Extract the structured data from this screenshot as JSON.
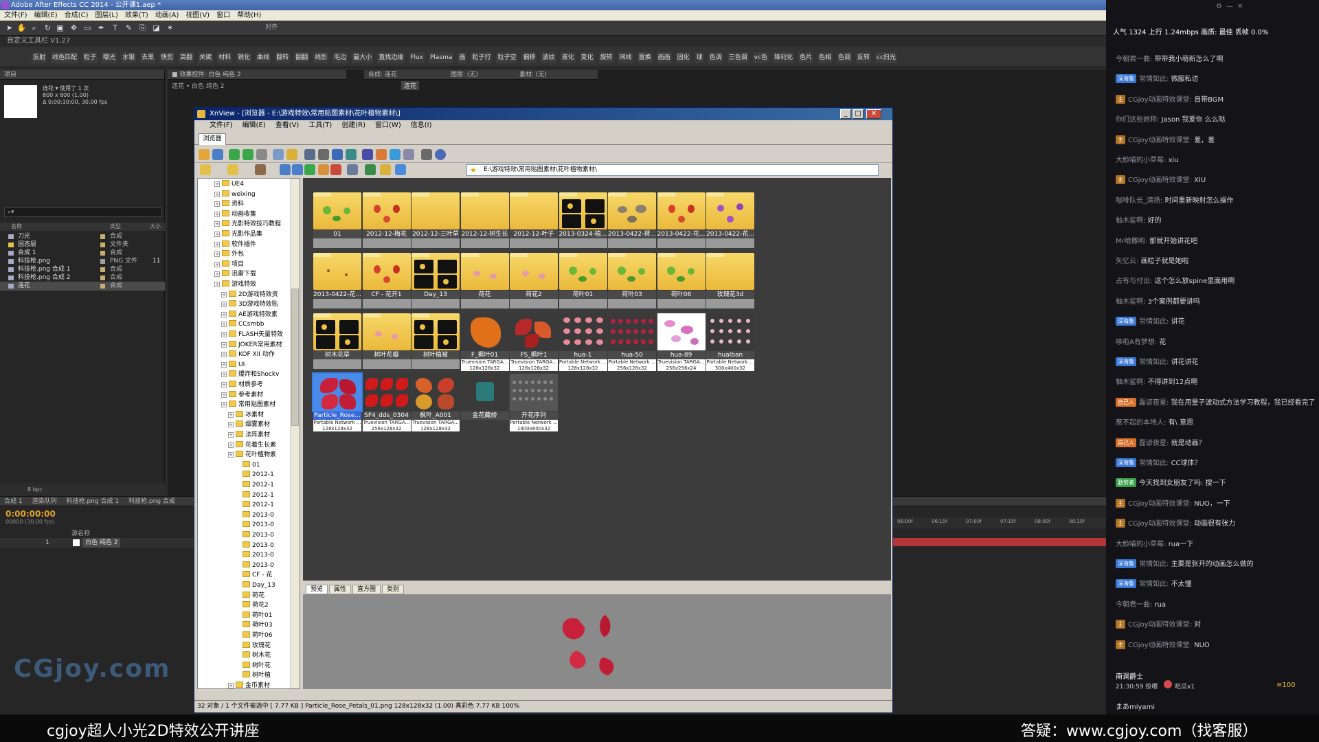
{
  "ae": {
    "title": "Adobe After Effects CC 2014 - 公开课1.aep *",
    "menu": [
      "文件(F)",
      "编辑(E)",
      "合成(C)",
      "图层(L)",
      "效果(T)",
      "动画(A)",
      "视图(V)",
      "窗口",
      "帮助(H)"
    ],
    "workspace": "自定义工具栏 V1.27",
    "snap_label": "对齐",
    "fx_buttons": [
      "反射",
      "线色匹配",
      "粒子",
      "曝光",
      "水银",
      "去黑",
      "快剪",
      "高翻",
      "关键",
      "材料",
      "锐化",
      "曲线",
      "翻转",
      "翻翻",
      "线影",
      "毛边",
      "最大小",
      "直找边缘",
      "Flux",
      "Plasma",
      "画",
      "粒子打",
      "粒子空",
      "偏移",
      "波纹",
      "液化",
      "变化",
      "旋转",
      "网线",
      "置换",
      "画画",
      "固化",
      "球",
      "色调",
      "三色调",
      "vc色",
      "锋利化",
      "色片",
      "色相",
      "色调",
      "反转",
      "cc扫光"
    ],
    "project": {
      "tab": "项目",
      "item_name": "连花",
      "used": "使用了 1 次",
      "meta": [
        "800 x 800 (1.00)",
        "Δ 0:00:10:00, 30.00 fps"
      ],
      "columns": [
        "名称",
        "类型",
        "大小"
      ],
      "rows": [
        {
          "name": "刀光",
          "type": "合成"
        },
        {
          "name": "固态层",
          "type": "文件夹"
        },
        {
          "name": "合成 1",
          "type": "合成"
        },
        {
          "name": "科技枪.png",
          "type": "PNG 文件",
          "size": "11"
        },
        {
          "name": "科技枪.png 合成 1",
          "type": "合成"
        },
        {
          "name": "科技枪.png 合成 2",
          "type": "合成"
        },
        {
          "name": "连花",
          "type": "合成"
        }
      ],
      "bpc": "8 bpc"
    },
    "effect_controls_tab": "效果控件: 白色 纯色 2",
    "effect_subtitle": "连花 • 白色 纯色 2",
    "comp_tab": "合成: 连花",
    "comp_sub": "连花",
    "layer_tab": "图层: (无)",
    "footage_tab": "素材: (无)",
    "timeline": {
      "tabs": [
        "合成 1",
        "渲染队列",
        "科技枪.png 合成 1",
        "科技枪.png 合成"
      ],
      "time": "0:00:00:00",
      "fps": "00000 (30.00 fps)",
      "layer_header": "源名称",
      "layer_index": "1",
      "layer_name": "白色 纯色 2",
      "ticks": [
        "06:00f",
        "06:15f",
        "07:00f",
        "07:15f",
        "08:00f",
        "08:15f"
      ]
    },
    "watermark": "CGjoy.com"
  },
  "xnview": {
    "title": "XnView - [浏览器 - E:\\游戏特效\\常用贴图素材\\花叶植物素材\\]",
    "menu": [
      "文件(F)",
      "编辑(E)",
      "查看(V)",
      "工具(T)",
      "创建(R)",
      "窗口(W)",
      "信息(I)"
    ],
    "tab": "浏览器",
    "address": "E:\\游戏特效\\常用贴图素材\\花叶植物素材\\",
    "tree": [
      {
        "label": "UE4",
        "lvl": 1
      },
      {
        "label": "weixing",
        "lvl": 1
      },
      {
        "label": "资料",
        "lvl": 1
      },
      {
        "label": "动画收集",
        "lvl": 1
      },
      {
        "label": "光影特效技巧教程",
        "lvl": 1
      },
      {
        "label": "光影作品集",
        "lvl": 1
      },
      {
        "label": "软件插件",
        "lvl": 1
      },
      {
        "label": "外包",
        "lvl": 1
      },
      {
        "label": "项目",
        "lvl": 1
      },
      {
        "label": "迅雷下载",
        "lvl": 1
      },
      {
        "label": "游戏特效",
        "lvl": 1
      },
      {
        "label": "2D游戏特效资",
        "lvl": 2
      },
      {
        "label": "3D游戏特效贴",
        "lvl": 2
      },
      {
        "label": "AE游戏特效素",
        "lvl": 2
      },
      {
        "label": "CCsmbb",
        "lvl": 2
      },
      {
        "label": "FLASH矢量特效",
        "lvl": 2
      },
      {
        "label": "JOKER常用素材",
        "lvl": 2
      },
      {
        "label": "KOF XII 动作",
        "lvl": 2
      },
      {
        "label": "UI",
        "lvl": 2
      },
      {
        "label": "爆炸和Shockv",
        "lvl": 2
      },
      {
        "label": "材质参考",
        "lvl": 2
      },
      {
        "label": "参考素材",
        "lvl": 2
      },
      {
        "label": "常用贴图素材",
        "lvl": 2
      },
      {
        "label": "冰素材",
        "lvl": 3
      },
      {
        "label": "烟雾素材",
        "lvl": 3
      },
      {
        "label": "法阵素材",
        "lvl": 3
      },
      {
        "label": "花着生长素",
        "lvl": 3
      },
      {
        "label": "花叶植物素",
        "lvl": 3
      },
      {
        "label": "01",
        "lvl": 4
      },
      {
        "label": "2012-1",
        "lvl": 4
      },
      {
        "label": "2012-1",
        "lvl": 4
      },
      {
        "label": "2012-1",
        "lvl": 4
      },
      {
        "label": "2012-1",
        "lvl": 4
      },
      {
        "label": "2013-0",
        "lvl": 4
      },
      {
        "label": "2013-0",
        "lvl": 4
      },
      {
        "label": "2013-0",
        "lvl": 4
      },
      {
        "label": "2013-0",
        "lvl": 4
      },
      {
        "label": "2013-0",
        "lvl": 4
      },
      {
        "label": "2013-0",
        "lvl": 4
      },
      {
        "label": "CF - 花",
        "lvl": 4
      },
      {
        "label": "Day_13",
        "lvl": 4
      },
      {
        "label": "荷花",
        "lvl": 4
      },
      {
        "label": "荷花2",
        "lvl": 4
      },
      {
        "label": "荷叶01",
        "lvl": 4
      },
      {
        "label": "荷叶03",
        "lvl": 4
      },
      {
        "label": "荷叶06",
        "lvl": 4
      },
      {
        "label": "玫瑰花",
        "lvl": 4
      },
      {
        "label": "树木花",
        "lvl": 4
      },
      {
        "label": "树叶花",
        "lvl": 4
      },
      {
        "label": "树叶植",
        "lvl": 4
      },
      {
        "label": "金币素材",
        "lvl": 3
      }
    ],
    "thumbs": [
      {
        "label": "01",
        "kind": "folder",
        "deco": "green"
      },
      {
        "label": "2012-12-梅花",
        "kind": "folder",
        "deco": "red"
      },
      {
        "label": "2012-12-三叶草",
        "kind": "folder",
        "deco": "none"
      },
      {
        "label": "2012-12-树生长",
        "kind": "folder",
        "deco": "none"
      },
      {
        "label": "2012-12-叶子",
        "kind": "folder",
        "deco": "none"
      },
      {
        "label": "2013-0324-植...",
        "kind": "folder",
        "deco": "dark"
      },
      {
        "label": "2013-0422-荷...",
        "kind": "folder",
        "deco": "grey"
      },
      {
        "label": "2013-0422-花...",
        "kind": "folder",
        "deco": "red"
      },
      {
        "label": "2013-0422-花...",
        "kind": "folder",
        "deco": "purple"
      },
      {
        "label": "2013-0422-花...",
        "kind": "folder",
        "deco": "dots"
      },
      {
        "label": "CF - 花开1",
        "kind": "folder",
        "deco": "red"
      },
      {
        "label": "Day_13",
        "kind": "folder",
        "deco": "dark"
      },
      {
        "label": "荷花",
        "kind": "folder",
        "deco": "pink"
      },
      {
        "label": "荷花2",
        "kind": "folder",
        "deco": "pink"
      },
      {
        "label": "荷叶01",
        "kind": "folder",
        "deco": "green"
      },
      {
        "label": "荷叶03",
        "kind": "folder",
        "deco": "green"
      },
      {
        "label": "荷叶06",
        "kind": "folder",
        "deco": "green"
      },
      {
        "label": "玫瑰花3d",
        "kind": "folder",
        "deco": "none"
      },
      {
        "label": "树木花草",
        "kind": "folder",
        "deco": "dark"
      },
      {
        "label": "树叶花瓣",
        "kind": "folder",
        "deco": "pink"
      },
      {
        "label": "树叶植被",
        "kind": "folder",
        "deco": "dark"
      },
      {
        "label": "F_枫叶01",
        "kind": "file",
        "deco": "maple",
        "sub": "Truevision TARGA...",
        "size": "128x128x32"
      },
      {
        "label": "FS_枫叶1",
        "kind": "file",
        "deco": "redleaf",
        "sub": "Truevision TARGA...",
        "size": "128x128x32"
      },
      {
        "label": "hua-1",
        "kind": "file",
        "deco": "petals",
        "sub": "Portable Network ...",
        "size": "128x128x32"
      },
      {
        "label": "hua-50",
        "kind": "file",
        "deco": "petals2",
        "sub": "Portable Network ...",
        "size": "256x128x32"
      },
      {
        "label": "hua-89",
        "kind": "file",
        "deco": "pinkpetals",
        "sub": "Truevision TARGA...",
        "size": "256x256x24"
      },
      {
        "label": "hualban",
        "kind": "file",
        "deco": "petals3",
        "sub": "Portable Network ...",
        "size": "500x400x32"
      },
      {
        "label": "Particle_Rose...",
        "kind": "file",
        "deco": "rose",
        "sub": "Portable Network ...",
        "size": "128x128x32",
        "selected": true
      },
      {
        "label": "SF4_dds_0304",
        "kind": "file",
        "deco": "redmany",
        "sub": "Truevision TARGA...",
        "size": "256x128x32"
      },
      {
        "label": "枫叶_A001",
        "kind": "file",
        "deco": "maple4",
        "sub": "Truevision TARGA...",
        "size": "128x128x32"
      },
      {
        "label": "金花藏娇",
        "kind": "file",
        "deco": "icon",
        "sub": "",
        "size": ""
      },
      {
        "label": "开花序列",
        "kind": "file",
        "deco": "seq",
        "sub": "Portable Network ...",
        "size": "1400x600x32"
      }
    ],
    "preview_tabs": [
      "预览",
      "属性",
      "直方图",
      "类别"
    ],
    "status": "32 对象 / 1 个文件被选中  [ 7.77 KB ]   Particle_Rose_Petals_01.png   128x128x32 (1.00)   真彩色   7.77 KB   100%"
  },
  "chat": {
    "top": "人气 1324    上行 1.24mbps   画质: 最佳   丢帧 0.0%",
    "messages": [
      {
        "user": "今朝君一曲:",
        "text": "带带我小萌新怎么了啊"
      },
      {
        "badge": "深海鲁",
        "badge_color": "#3a78d8",
        "user": "常情如此:",
        "text": "微服私访"
      },
      {
        "badge": "主",
        "badge_color": "#b07020",
        "user": "CGjoy动画特效课堂:",
        "text": "自带BGM"
      },
      {
        "user": "你们这些她称:",
        "text": "Jason 我爱你 么么哒"
      },
      {
        "badge": "主",
        "badge_color": "#b07020",
        "user": "CGjoy动画特效课堂:",
        "text": "差，差"
      },
      {
        "user": "大脸喵的小草莓:",
        "text": "xiu"
      },
      {
        "badge": "主",
        "badge_color": "#b07020",
        "user": "CGjoy动画特效课堂:",
        "text": "XIU"
      },
      {
        "user": "咖啡队长_清扬:",
        "text": "时间重新映射怎么操作"
      },
      {
        "user": "柚木鲨啊:",
        "text": "好的"
      },
      {
        "user": "Mr哈撒哟:",
        "text": "那就开始讲花吧"
      },
      {
        "user": "矢忆云:",
        "text": "画粒子就是她啦"
      },
      {
        "user": "占有与付出:",
        "text": "这个怎么放spine里面用啊"
      },
      {
        "user": "柚木鲨啊:",
        "text": "3个案例都要讲吗"
      },
      {
        "badge": "深海鲁",
        "badge_color": "#3a78d8",
        "user": "常情如此:",
        "text": "讲花"
      },
      {
        "user": "哆啦A有梦想:",
        "text": "花"
      },
      {
        "badge": "深海鲁",
        "badge_color": "#3a78d8",
        "user": "常情如此:",
        "text": "讲花讲花"
      },
      {
        "user": "柚木鲨啊:",
        "text": "不得讲到12点啊"
      },
      {
        "badge": "自己人",
        "badge_color": "#d8702a",
        "user": "磊谚夜星:",
        "text": "我在用量子波动式方法学习教程，我已经看完了公开课"
      },
      {
        "user": "惹不起的本地人:",
        "text": "有\\ 意思"
      },
      {
        "badge": "自己人",
        "badge_color": "#d8702a",
        "user": "磊谚夜星:",
        "text": "就是动画？"
      },
      {
        "badge": "深海鲁",
        "badge_color": "#3a78d8",
        "user": "常情如此:",
        "text": "CC球体？"
      },
      {
        "badge": "勤劳者",
        "badge_color": "#3aa04a",
        "user": "",
        "text": "今天找到女朋友了吗: 搜一下"
      },
      {
        "badge": "主",
        "badge_color": "#b07020",
        "user": "CGjoy动画特效课堂:",
        "text": "NUO，一下"
      },
      {
        "badge": "主",
        "badge_color": "#b07020",
        "user": "CGjoy动画特效课堂:",
        "text": "动画很有张力"
      },
      {
        "user": "大脸喵的小草莓:",
        "text": "rua一下"
      },
      {
        "badge": "深海鲁",
        "badge_color": "#3a78d8",
        "user": "常情如此:",
        "text": "主要是张开的动画怎么做的"
      },
      {
        "badge": "深海鲁",
        "badge_color": "#3a78d8",
        "user": "常情如此:",
        "text": "不太懂"
      },
      {
        "user": "今朝君一曲:",
        "text": "rua"
      },
      {
        "badge": "主",
        "badge_color": "#b07020",
        "user": "CGjoy动画特效课堂:",
        "text": "对"
      },
      {
        "badge": "主",
        "badge_color": "#b07020",
        "user": "CGjoy动画特效课堂:",
        "text": "NUO"
      }
    ],
    "gift_user": "南调爵士",
    "gift_time": "21:30:59 投喂",
    "gift_item": "吃瓜x1",
    "gift_count": "100",
    "last_user": "まあmiyami"
  },
  "bottom": {
    "left": "cgjoy超人小光2D特效公开讲座",
    "right": "答疑：www.cgjoy.com（找客服）"
  }
}
